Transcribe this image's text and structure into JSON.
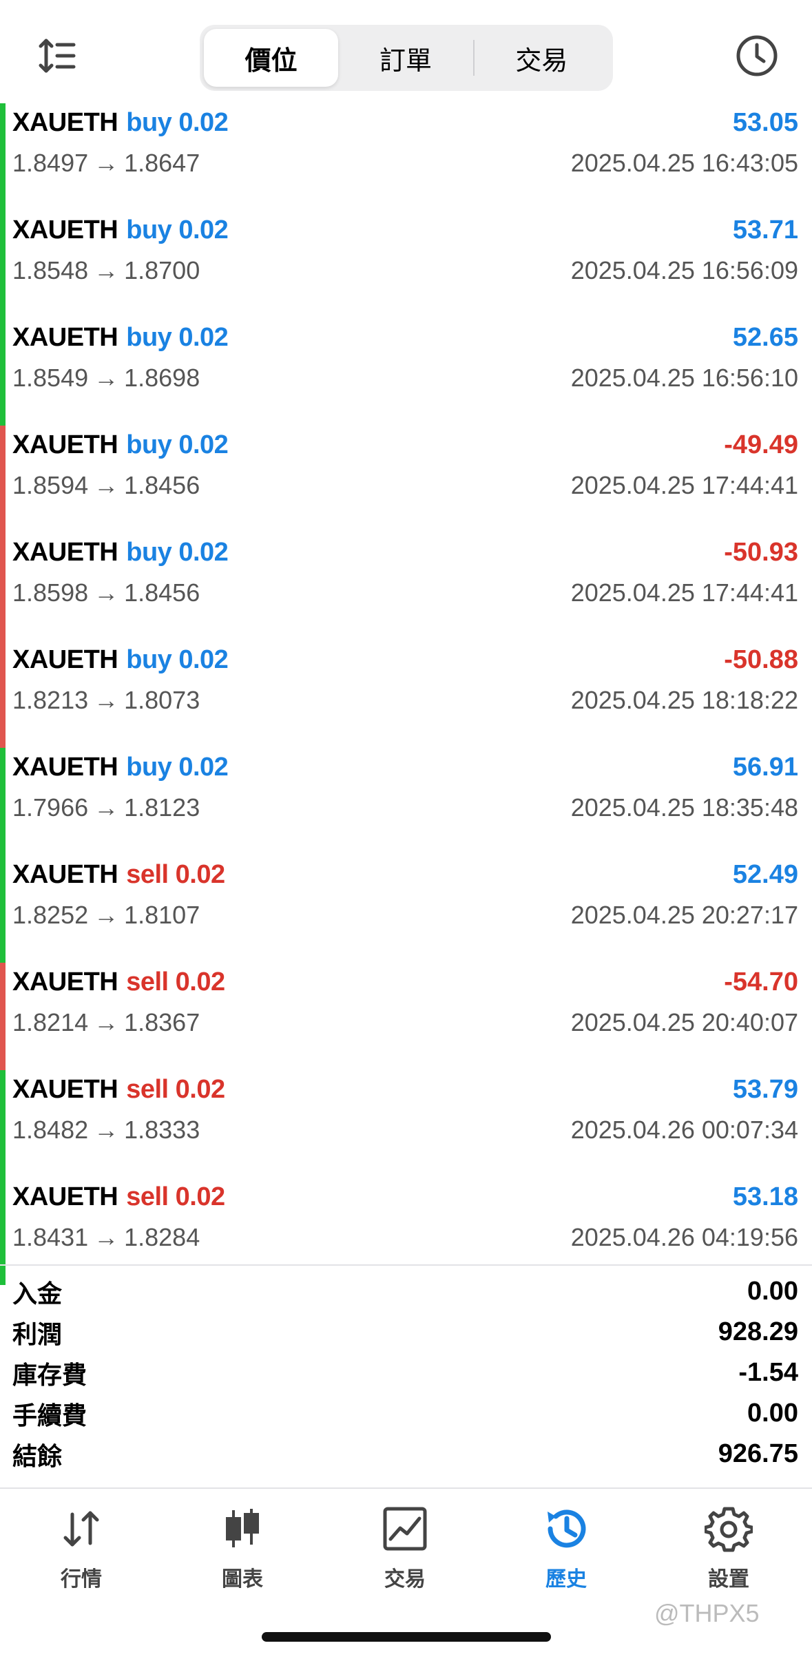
{
  "header": {
    "tabs": [
      "價位",
      "訂單",
      "交易"
    ],
    "active_tab": 0,
    "sort_icon": "sort-icon",
    "history_icon": "clock-icon"
  },
  "trades": [
    {
      "symbol": "XAUETH",
      "side": "buy",
      "lot": "buy 0.02",
      "profit": "53.05",
      "open": "1.8497",
      "close": "1.8647",
      "time": "2025.04.25 16:43:05",
      "result": "win"
    },
    {
      "symbol": "XAUETH",
      "side": "buy",
      "lot": "buy 0.02",
      "profit": "53.71",
      "open": "1.8548",
      "close": "1.8700",
      "time": "2025.04.25 16:56:09",
      "result": "win"
    },
    {
      "symbol": "XAUETH",
      "side": "buy",
      "lot": "buy 0.02",
      "profit": "52.65",
      "open": "1.8549",
      "close": "1.8698",
      "time": "2025.04.25 16:56:10",
      "result": "win"
    },
    {
      "symbol": "XAUETH",
      "side": "buy",
      "lot": "buy 0.02",
      "profit": "-49.49",
      "open": "1.8594",
      "close": "1.8456",
      "time": "2025.04.25 17:44:41",
      "result": "loss"
    },
    {
      "symbol": "XAUETH",
      "side": "buy",
      "lot": "buy 0.02",
      "profit": "-50.93",
      "open": "1.8598",
      "close": "1.8456",
      "time": "2025.04.25 17:44:41",
      "result": "loss"
    },
    {
      "symbol": "XAUETH",
      "side": "buy",
      "lot": "buy 0.02",
      "profit": "-50.88",
      "open": "1.8213",
      "close": "1.8073",
      "time": "2025.04.25 18:18:22",
      "result": "loss"
    },
    {
      "symbol": "XAUETH",
      "side": "buy",
      "lot": "buy 0.02",
      "profit": "56.91",
      "open": "1.7966",
      "close": "1.8123",
      "time": "2025.04.25 18:35:48",
      "result": "win"
    },
    {
      "symbol": "XAUETH",
      "side": "sell",
      "lot": "sell 0.02",
      "profit": "52.49",
      "open": "1.8252",
      "close": "1.8107",
      "time": "2025.04.25 20:27:17",
      "result": "win"
    },
    {
      "symbol": "XAUETH",
      "side": "sell",
      "lot": "sell 0.02",
      "profit": "-54.70",
      "open": "1.8214",
      "close": "1.8367",
      "time": "2025.04.25 20:40:07",
      "result": "loss"
    },
    {
      "symbol": "XAUETH",
      "side": "sell",
      "lot": "sell 0.02",
      "profit": "53.79",
      "open": "1.8482",
      "close": "1.8333",
      "time": "2025.04.26 00:07:34",
      "result": "win"
    },
    {
      "symbol": "XAUETH",
      "side": "sell",
      "lot": "sell 0.02",
      "profit": "53.18",
      "open": "1.8431",
      "close": "1.8284",
      "time": "2025.04.26 04:19:56",
      "result": "win"
    }
  ],
  "arrow": "→",
  "summary": [
    {
      "label": "入金",
      "value": "0.00"
    },
    {
      "label": "利潤",
      "value": "928.29"
    },
    {
      "label": "庫存費",
      "value": "-1.54"
    },
    {
      "label": "手續費",
      "value": "0.00"
    },
    {
      "label": "結餘",
      "value": "926.75"
    }
  ],
  "tabbar": [
    {
      "label": "行情",
      "icon": "arrows-updown-icon"
    },
    {
      "label": "圖表",
      "icon": "candlestick-icon"
    },
    {
      "label": "交易",
      "icon": "chart-line-icon"
    },
    {
      "label": "歷史",
      "icon": "history-icon"
    },
    {
      "label": "設置",
      "icon": "gear-icon"
    }
  ],
  "active_tabbar": 3,
  "watermark": "@THPX5",
  "colors": {
    "blue": "#1a82e2",
    "red": "#d9342b",
    "green": "#1fbf3a"
  }
}
